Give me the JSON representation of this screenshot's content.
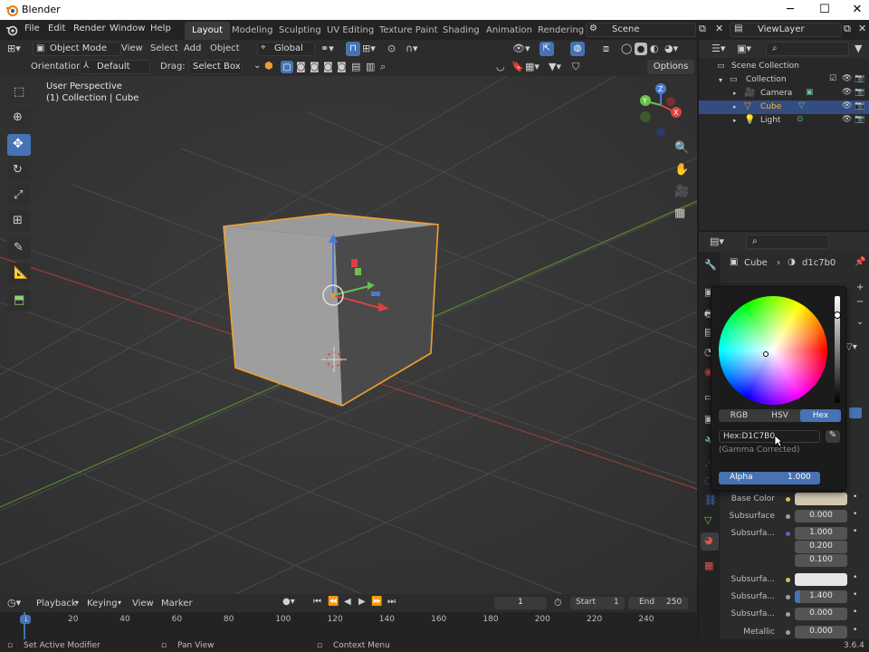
{
  "window": {
    "title": "Blender",
    "minimize": "─",
    "maximize": "☐",
    "close": "✕"
  },
  "menu": [
    "File",
    "Edit",
    "Render",
    "Window",
    "Help"
  ],
  "workspaces": [
    "Layout",
    "Modeling",
    "Sculpting",
    "UV Editing",
    "Texture Paint",
    "Shading",
    "Animation",
    "Rendering"
  ],
  "scene": {
    "name": "Scene",
    "view_layer": "ViewLayer"
  },
  "viewport_header": {
    "mode": "Object Mode",
    "view": "View",
    "select": "Select",
    "add": "Add",
    "object": "Object",
    "transform": "Global"
  },
  "tool_header": {
    "orientation_label": "Orientation:",
    "orientation": "Default",
    "drag_label": "Drag:",
    "drag": "Select Box",
    "options": "Options"
  },
  "viewport": {
    "perspective": "User Perspective",
    "collection": "(1) Collection | Cube"
  },
  "outliner": {
    "root": "Scene Collection",
    "collection": "Collection",
    "items": [
      {
        "name": "Camera",
        "selected": false
      },
      {
        "name": "Cube",
        "selected": true
      },
      {
        "name": "Light",
        "selected": false
      }
    ]
  },
  "properties": {
    "breadcrumb_object": "Cube",
    "breadcrumb_material": "d1c7b0",
    "rows": [
      {
        "label": "Base Color",
        "value": "",
        "color": "#d1c7b0",
        "dot": "#c8c850"
      },
      {
        "label": "Subsurface",
        "value": "0.000",
        "dot": "#a0a0a0"
      },
      {
        "label": "Subsurfa...",
        "value": "1.000",
        "dot": "#6060c8"
      },
      {
        "label": "",
        "value": "0.200"
      },
      {
        "label": "",
        "value": "0.100"
      },
      {
        "label": "Subsurfa...",
        "value": "",
        "color": "#e6e6e6",
        "dot": "#c8c850"
      },
      {
        "label": "Subsurfa...",
        "value": "1.400",
        "dot": "#a0a0a0"
      },
      {
        "label": "Subsurfa...",
        "value": "0.000",
        "dot": "#a0a0a0"
      },
      {
        "label": "Metallic",
        "value": "0.000",
        "dot": "#a0a0a0"
      }
    ]
  },
  "color_picker": {
    "tabs": [
      "RGB",
      "HSV",
      "Hex"
    ],
    "active_tab": "Hex",
    "hex_value": "Hex:D1C7B0",
    "gamma_note": "(Gamma Corrected)",
    "alpha_label": "Alpha",
    "alpha_value": "1.000"
  },
  "timeline": {
    "playback": "Playback",
    "keying": "Keying",
    "view": "View",
    "marker": "Marker",
    "current_frame": "1",
    "start_label": "Start",
    "start": "1",
    "end_label": "End",
    "end": "250",
    "ruler": [
      "1",
      "20",
      "40",
      "60",
      "80",
      "100",
      "120",
      "140",
      "160",
      "180",
      "200",
      "220",
      "240"
    ]
  },
  "statusbar": {
    "left": "Set Active Modifier",
    "middle": "Pan View",
    "right": "Context Menu",
    "version": "3.6.4"
  },
  "colors": {
    "accent": "#4772b3",
    "selection_outline": "#f0a030",
    "material": "#d1c7b0"
  }
}
